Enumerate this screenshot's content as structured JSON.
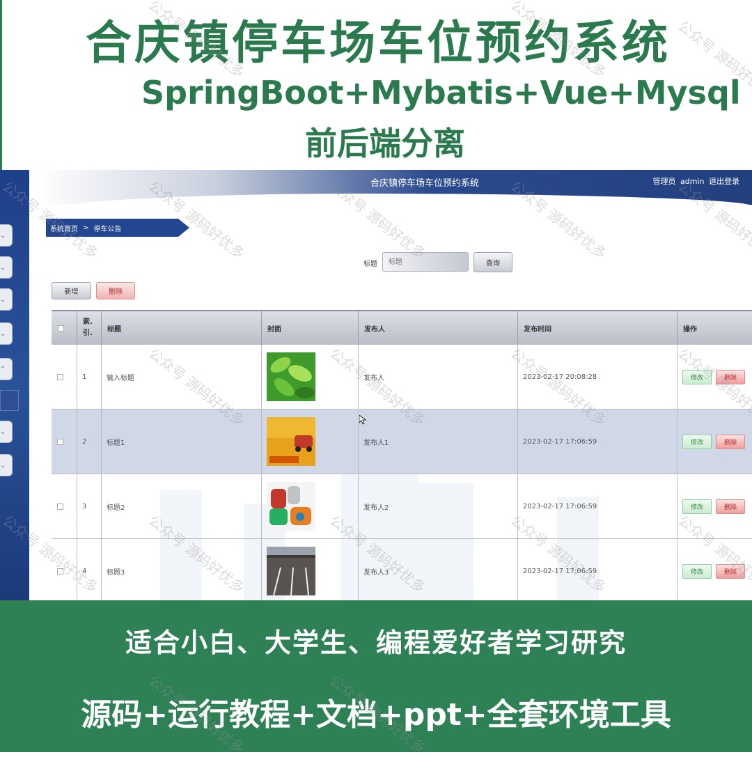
{
  "promo": {
    "title": "合庆镇停车场车位预约系统",
    "stack": "SpringBoot+Mybatis+Vue+Mysql",
    "subtitle": "前后端分离",
    "audience": "适合小白、大学生、编程爱好者学习研究",
    "package": "源码+运行教程+文档+ppt+全套环境工具"
  },
  "watermark": "公众号 源码好优多",
  "app": {
    "title": "合庆镇停车场车位预约系统",
    "user_role": "管理员",
    "user_name": "admin",
    "logout": "退出登录"
  },
  "breadcrumb": {
    "home": "系统首页",
    "separator": ">",
    "current": "停车公告"
  },
  "search": {
    "label": "标题",
    "placeholder": "标题",
    "button": "查询"
  },
  "toolbar": {
    "add": "新增",
    "delete": "删除"
  },
  "table": {
    "columns": [
      "",
      "索引",
      "标题",
      "封面",
      "发布人",
      "发布时间",
      "操作"
    ],
    "index_header_line1": "索.",
    "index_header_line2": "引.",
    "rows": [
      {
        "index": "1",
        "title": "输入标题",
        "cover": "green-leaves-image",
        "publisher": "发布人",
        "time": "2023-02-17 20:08:28",
        "edit": "修改",
        "delete": "删除"
      },
      {
        "index": "2",
        "title": "标题1",
        "cover": "parking-sign-image",
        "publisher": "发布人1",
        "time": "2023-02-17 17:06:59",
        "edit": "修改",
        "delete": "删除"
      },
      {
        "index": "3",
        "title": "标题2",
        "cover": "cartoon-cars-image",
        "publisher": "发布人2",
        "time": "2023-02-17 17:06:59",
        "edit": "修改",
        "delete": "删除"
      },
      {
        "index": "4",
        "title": "标题3",
        "cover": "parking-lot-photo",
        "publisher": "发布人3",
        "time": "2023-02-17 17:06:59",
        "edit": "修改",
        "delete": "删除"
      }
    ]
  },
  "colors": {
    "promo_green": "#2a7a4d",
    "footer_green": "#2e8055",
    "nav_blue": "#22468f"
  }
}
